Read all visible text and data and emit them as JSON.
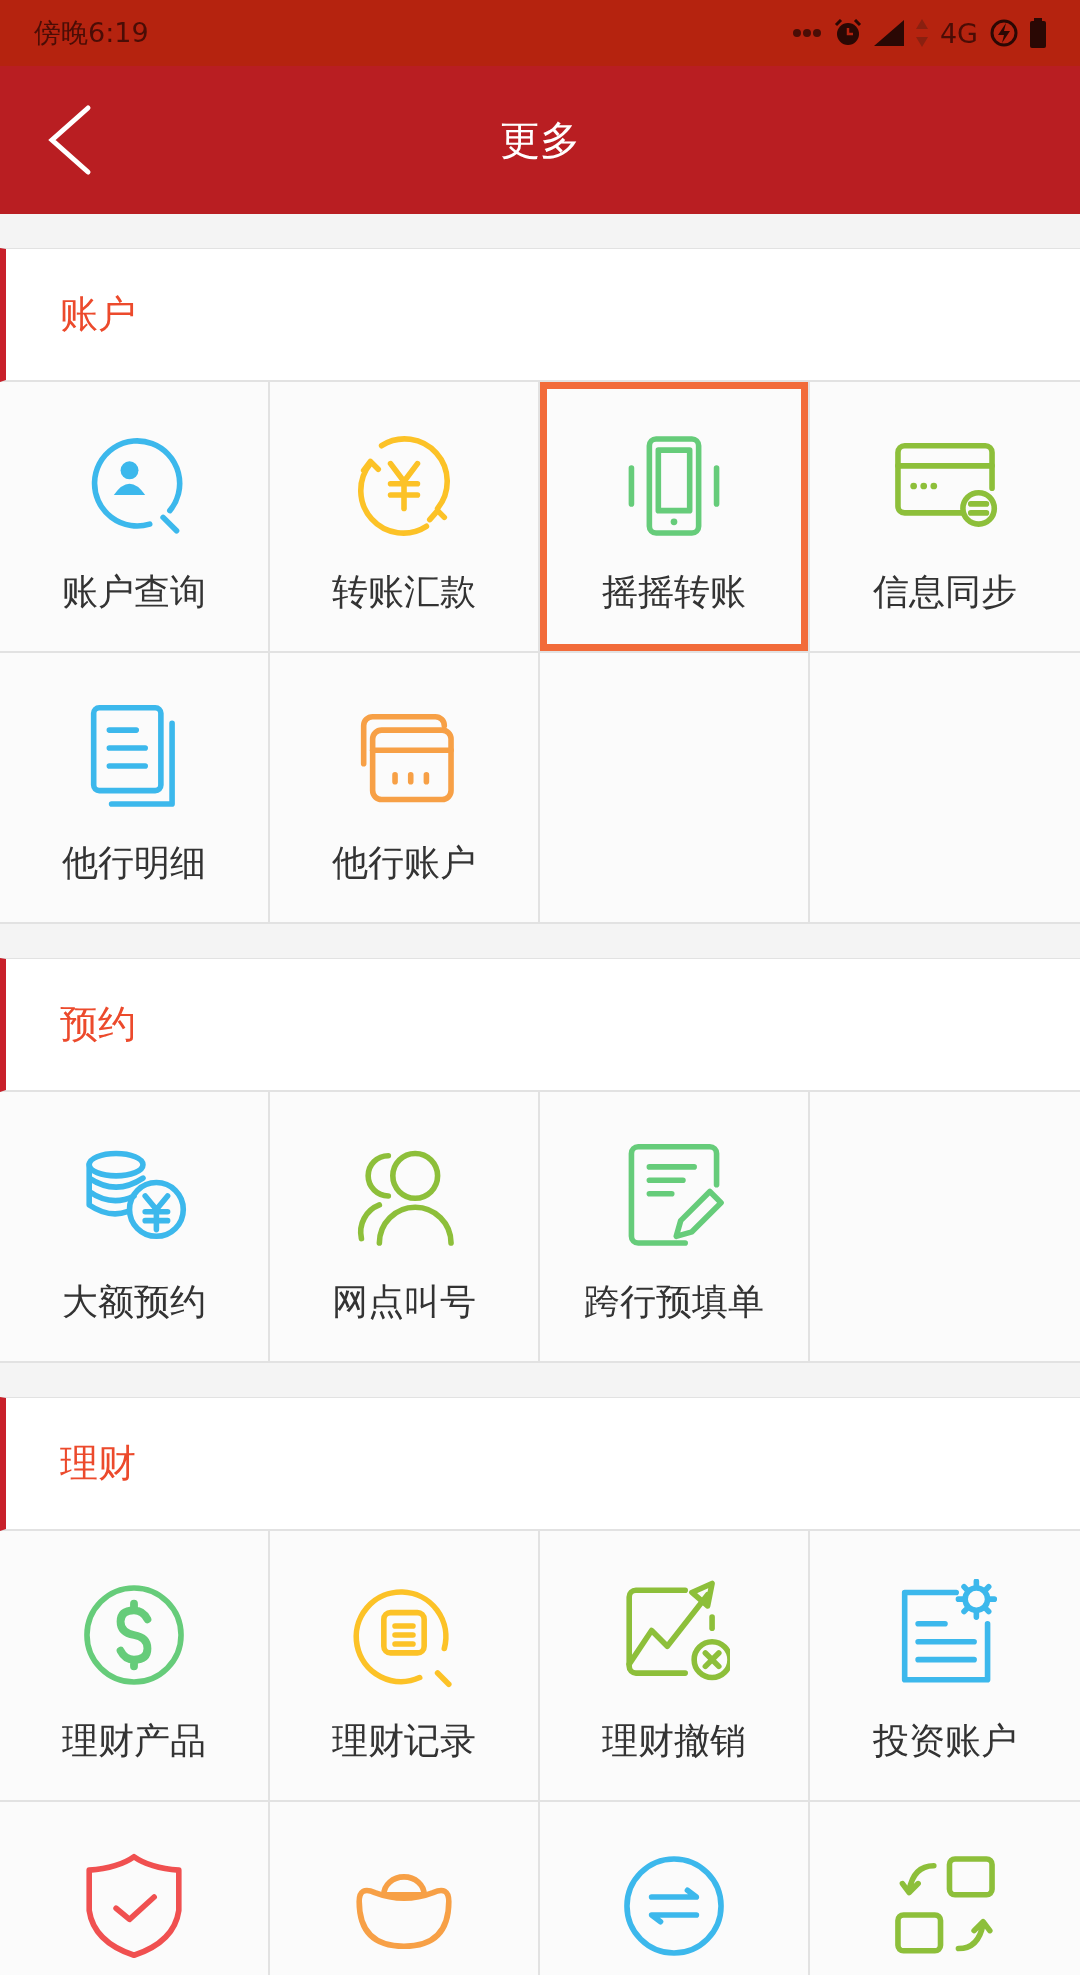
{
  "status_bar": {
    "time": "傍晚6:19",
    "network": "4G"
  },
  "header": {
    "title": "更多"
  },
  "sections": [
    {
      "title": "账户",
      "items": [
        {
          "label": "账户查询",
          "selected": false
        },
        {
          "label": "转账汇款",
          "selected": false
        },
        {
          "label": "摇摇转账",
          "selected": true
        },
        {
          "label": "信息同步",
          "selected": false
        },
        {
          "label": "他行明细",
          "selected": false
        },
        {
          "label": "他行账户",
          "selected": false
        }
      ]
    },
    {
      "title": "预约",
      "items": [
        {
          "label": "大额预约",
          "selected": false
        },
        {
          "label": "网点叫号",
          "selected": false
        },
        {
          "label": "跨行预填单",
          "selected": false
        }
      ]
    },
    {
      "title": "理财",
      "items": [
        {
          "label": "理财产品",
          "selected": false
        },
        {
          "label": "理财记录",
          "selected": false
        },
        {
          "label": "理财撤销",
          "selected": false
        },
        {
          "label": "投资账户",
          "selected": false
        },
        {
          "selected": false
        },
        {
          "selected": false
        },
        {
          "selected": false
        },
        {
          "selected": false
        }
      ]
    }
  ]
}
